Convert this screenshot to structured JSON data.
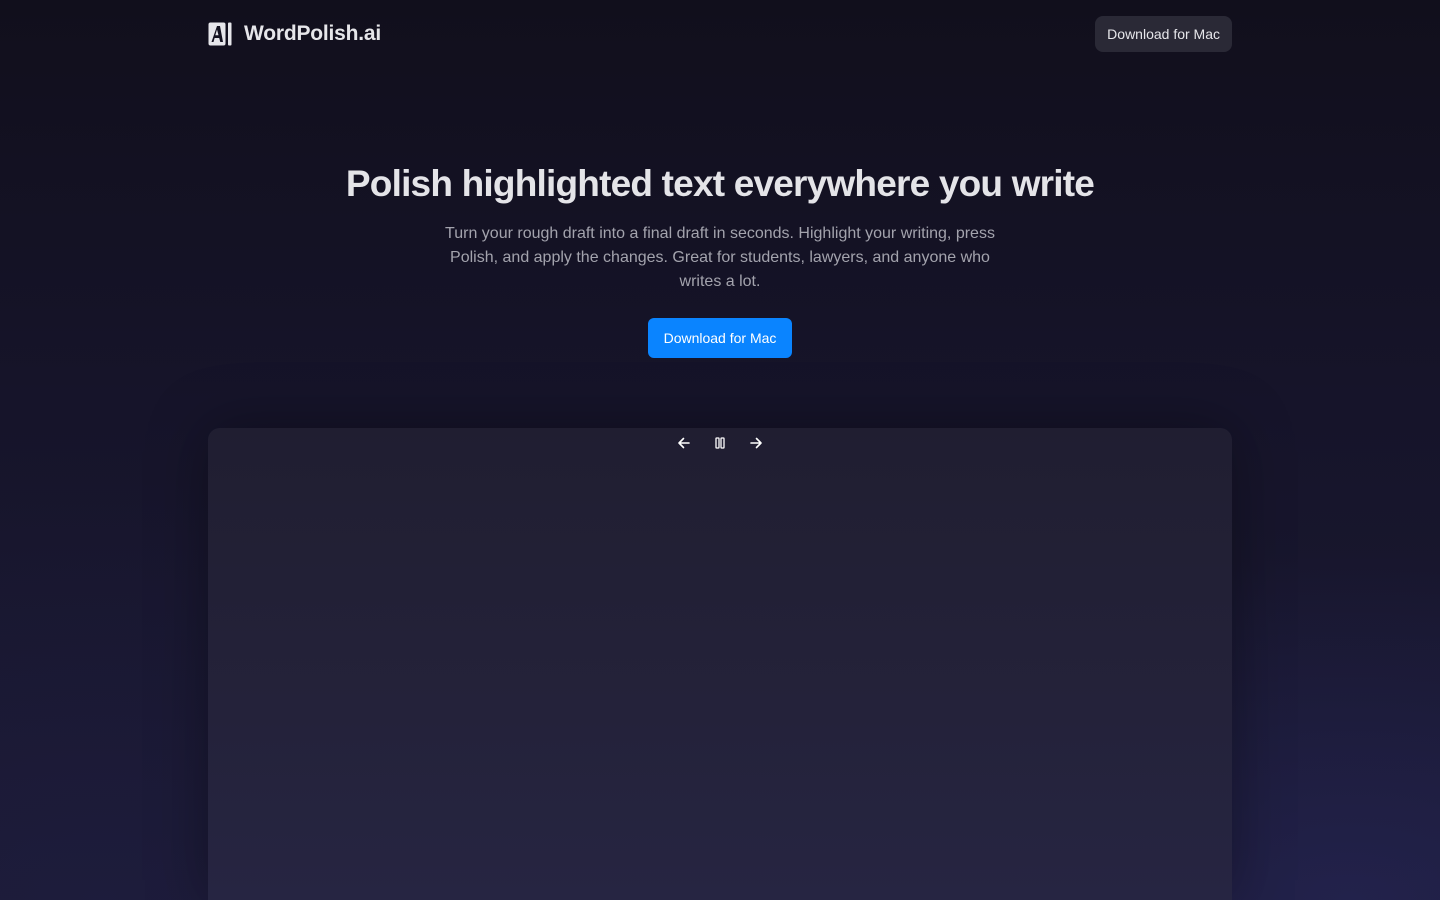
{
  "header": {
    "brand_name": "WordPolish.ai",
    "download_label": "Download for Mac"
  },
  "hero": {
    "title": "Polish highlighted text everywhere you write",
    "subtitle": "Turn your rough draft into a final draft in seconds. Highlight your writing, press Polish, and apply the changes. Great for students, lawyers, and anyone who writes a lot.",
    "cta_label": "Download for Mac"
  },
  "demo": {
    "controls": [
      "arrow-left-icon",
      "pause-icon",
      "arrow-right-icon"
    ]
  },
  "colors": {
    "accent": "#0a84ff",
    "background": "#13111f",
    "nav_button": "#2a2936"
  }
}
